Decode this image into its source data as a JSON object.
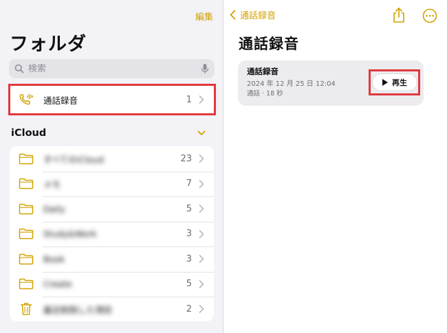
{
  "sidebar": {
    "edit_label": "編集",
    "title": "フォルダ",
    "search": {
      "placeholder": "検索",
      "icon": "search-icon",
      "mic_icon": "mic-icon"
    },
    "call_recordings": {
      "label": "通話録音",
      "count": "1",
      "icon": "phone-waveform-icon"
    },
    "icloud": {
      "header": "iCloud",
      "folders": [
        {
          "label": "すべてのiCloud",
          "count": "23",
          "icon": "folder-icon"
        },
        {
          "label": "メモ",
          "count": "7",
          "icon": "folder-icon"
        },
        {
          "label": "Daily",
          "count": "5",
          "icon": "folder-icon"
        },
        {
          "label": "Study&Work",
          "count": "3",
          "icon": "folder-icon"
        },
        {
          "label": "Book",
          "count": "3",
          "icon": "folder-icon"
        },
        {
          "label": "Create",
          "count": "5",
          "icon": "folder-icon"
        },
        {
          "label": "最近削除した項目",
          "count": "2",
          "icon": "trash-icon"
        }
      ]
    }
  },
  "detail": {
    "back_label": "通話録音",
    "title": "通話録音",
    "recording": {
      "title": "通話録音",
      "date": "2024 年 12 月 25 日 12:04",
      "meta": "通話 · 18 秒",
      "play_label": "再生"
    }
  },
  "colors": {
    "accent": "#d3a100",
    "highlight": "#e0383e",
    "sidebar_bg": "#f2f2f7"
  }
}
